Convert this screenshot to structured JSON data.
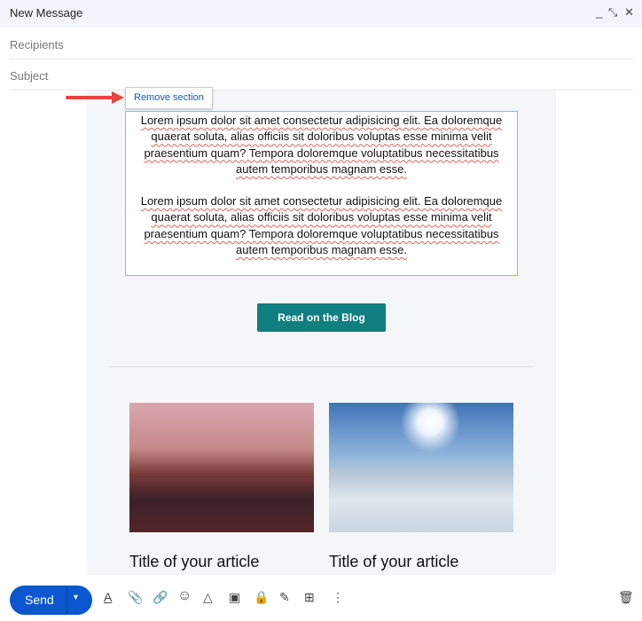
{
  "header": {
    "title": "New Message",
    "minimize": "_",
    "expand": "⤡",
    "close": "✕"
  },
  "fields": {
    "recipients": "Recipients",
    "subject": "Subject"
  },
  "remove_section": "Remove section",
  "body": {
    "paragraphs": [
      "Lorem ipsum dolor sit amet consectetur adipisicing elit. Ea doloremque quaerat soluta, alias officiis sit doloribus voluptas esse minima velit praesentium quam? Tempora doloremque voluptatibus necessitatibus autem temporibus magnam esse.",
      "Lorem ipsum dolor sit amet consectetur adipisicing elit. Ea doloremque quaerat soluta, alias officiis sit doloribus voluptas esse minima velit praesentium quam? Tempora doloremque voluptatibus necessitatibus autem temporibus magnam esse."
    ],
    "button": "Read on the Blog",
    "articles": [
      {
        "title": "Title of your article"
      },
      {
        "title": "Title of your article"
      }
    ]
  },
  "toolbar": {
    "send": "Send",
    "dropdown": "▾",
    "icons": [
      "format-text-icon",
      "attach-icon",
      "link-icon",
      "emoji-icon",
      "drive-icon",
      "photo-icon",
      "confidential-icon",
      "signature-icon",
      "layout-icon",
      "more-icon"
    ],
    "glyphs": [
      "A",
      "📎",
      "🔗",
      "☺",
      "△",
      "▣",
      "🔒",
      "✎",
      "⊞",
      "⋮"
    ],
    "trash": "🗑"
  },
  "colors": {
    "accent": "#0b57d0",
    "teal": "#0f7f80",
    "arrow": "#e8453c"
  }
}
